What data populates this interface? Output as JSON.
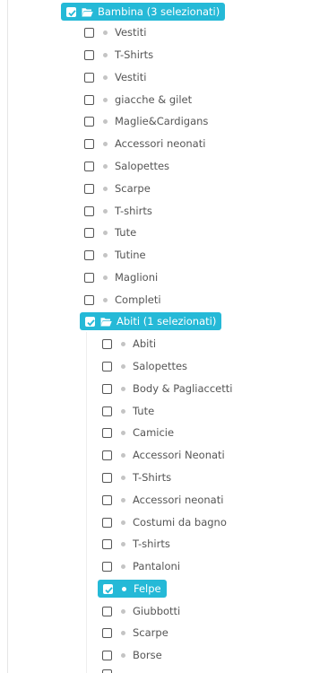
{
  "tree": {
    "root": {
      "label": "Bambina (3 selezionati)",
      "checked": true,
      "children": [
        {
          "label": "Vestiti",
          "checked": false
        },
        {
          "label": "T-Shirts",
          "checked": false
        },
        {
          "label": "Vestiti",
          "checked": false
        },
        {
          "label": "giacche & gilet",
          "checked": false
        },
        {
          "label": "Maglie&Cardigans",
          "checked": false
        },
        {
          "label": "Accessori neonati",
          "checked": false
        },
        {
          "label": "Salopettes",
          "checked": false
        },
        {
          "label": "Scarpe",
          "checked": false
        },
        {
          "label": "T-shirts",
          "checked": false
        },
        {
          "label": "Tute",
          "checked": false
        },
        {
          "label": "Tutine",
          "checked": false
        },
        {
          "label": "Maglioni",
          "checked": false
        },
        {
          "label": "Completi",
          "checked": false
        }
      ]
    },
    "abiti": {
      "label": "Abiti (1 selezionati)",
      "checked": true,
      "children": [
        {
          "label": "Abiti",
          "checked": false
        },
        {
          "label": "Salopettes",
          "checked": false
        },
        {
          "label": "Body & Pagliaccetti",
          "checked": false
        },
        {
          "label": "Tute",
          "checked": false
        },
        {
          "label": "Camicie",
          "checked": false
        },
        {
          "label": "Accessori Neonati",
          "checked": false
        },
        {
          "label": "T-Shirts",
          "checked": false
        },
        {
          "label": "Accessori neonati",
          "checked": false
        },
        {
          "label": "Costumi da bagno",
          "checked": false
        },
        {
          "label": "T-shirts",
          "checked": false
        },
        {
          "label": "Pantaloni",
          "checked": false
        },
        {
          "label": "Felpe",
          "checked": true
        },
        {
          "label": "Giubbotti",
          "checked": false
        },
        {
          "label": "Scarpe",
          "checked": false
        },
        {
          "label": "Borse",
          "checked": false
        }
      ]
    }
  },
  "colors": {
    "selected_bg": "#25b9d7",
    "text": "#555555",
    "bullet": "#c4c4c4"
  }
}
